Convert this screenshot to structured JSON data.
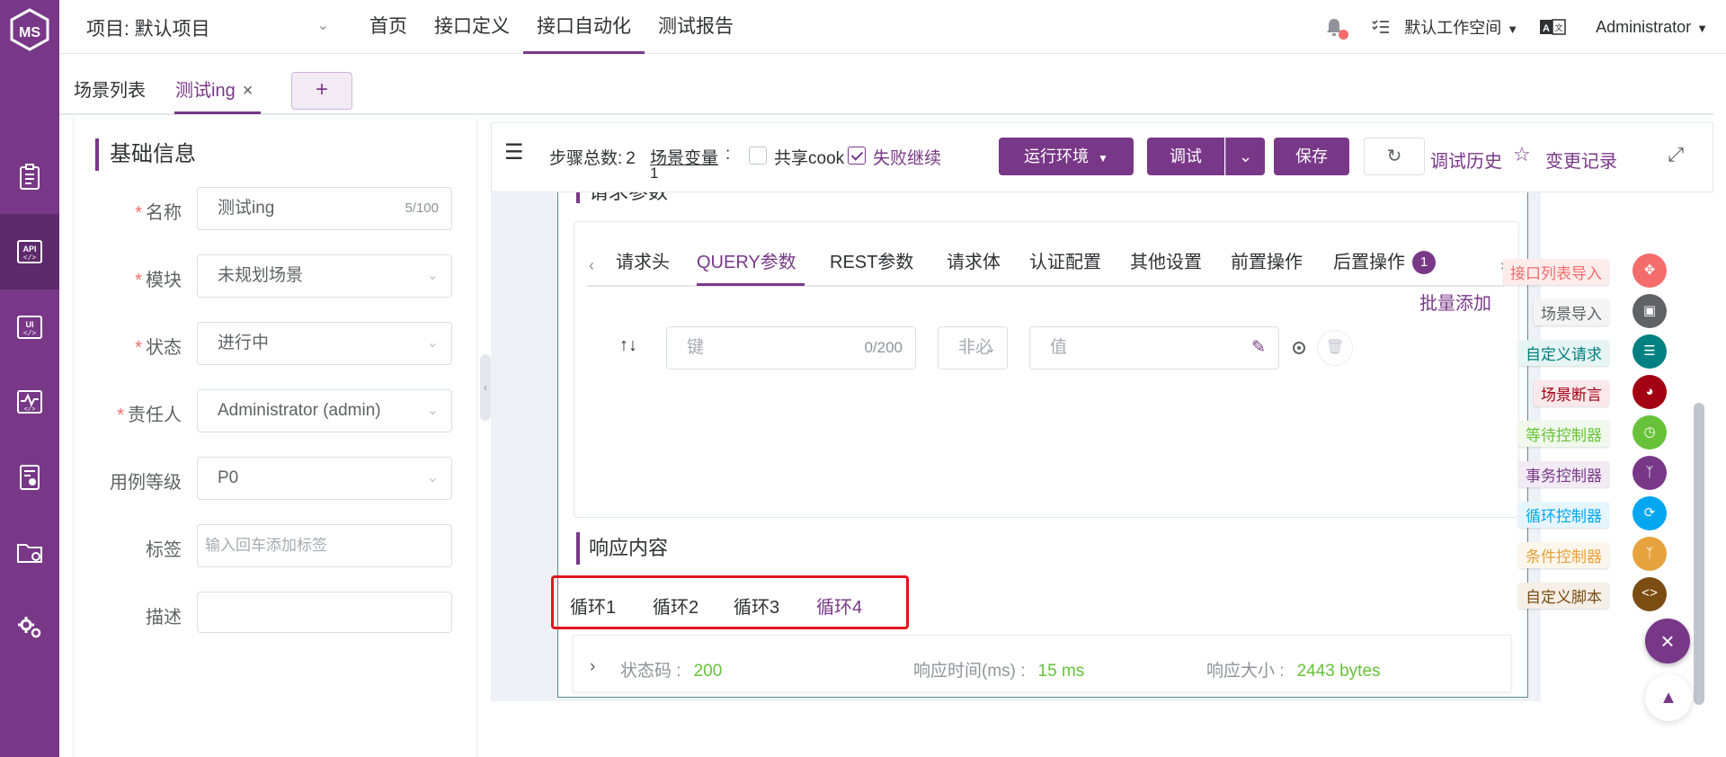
{
  "sidebar": {
    "logo_text": "MS",
    "items": [
      "clipboard-icon",
      "api-icon",
      "ui-icon",
      "performance-icon",
      "report-icon",
      "folder-settings-icon",
      "settings-icon"
    ]
  },
  "header": {
    "project": "项目: 默认项目",
    "nav": [
      "首页",
      "接口定义",
      "接口自动化",
      "测试报告"
    ],
    "workspace": "默认工作空间",
    "user": "Administrator"
  },
  "tabs": {
    "list": "场景列表",
    "active": "测试ing",
    "add": "+"
  },
  "form": {
    "title": "基础信息",
    "fields": [
      {
        "label": "名称",
        "value": "测试ing",
        "count": "5/100"
      },
      {
        "label": "模块",
        "value": "未规划场景"
      },
      {
        "label": "状态",
        "value": "进行中"
      },
      {
        "label": "责任人",
        "value": "Administrator (admin)"
      },
      {
        "label": "用例等级",
        "value": "P0"
      },
      {
        "label": "标签",
        "placeholder": "输入回车添加标签"
      },
      {
        "label": "描述",
        "value": ""
      }
    ]
  },
  "toolbar": {
    "step_total_label": "步骤总数:",
    "step_total": "2",
    "scenario_var": "场景变量",
    "scenario_var_colon": ":",
    "scenario_var_count": "1",
    "share_cookie": "共享cook",
    "fail_continue": "失败继续",
    "env": "运行环境",
    "debug": "调试",
    "save": "保存",
    "debug_history": "调试历史",
    "change_record": "变更记录"
  },
  "request": {
    "tabs": [
      "请求头",
      "QUERY参数",
      "REST参数",
      "请求体",
      "认证配置",
      "其他设置",
      "前置操作",
      "后置操作"
    ],
    "post_badge": "1",
    "batch_add": "批量添加",
    "key_placeholder": "键",
    "key_count": "0/200",
    "required": "非必",
    "value_placeholder": "值"
  },
  "response": {
    "title": "响应内容",
    "loops": [
      "循环1",
      "循环2",
      "循环3",
      "循环4"
    ],
    "status_label": "状态码 :",
    "status": "200",
    "time_label": "响应时间(ms) :",
    "time": "15 ms",
    "size_label": "响应大小 :",
    "size": "2443 bytes"
  },
  "steps": [
    {
      "label": "接口列表导入",
      "color": "#f56c6c",
      "text": "#f56c6c",
      "bg": "#fdecec"
    },
    {
      "label": "场景导入",
      "color": "#606266",
      "text": "#606266",
      "bg": "#f4f4f5"
    },
    {
      "label": "自定义请求",
      "color": "#008080",
      "text": "#008080",
      "bg": "#e6f4f4"
    },
    {
      "label": "场景断言",
      "color": "#a30014",
      "text": "#a30014",
      "bg": "#fbe8ea"
    },
    {
      "label": "等待控制器",
      "color": "#67c23a",
      "text": "#67c23a",
      "bg": "#f0f9eb"
    },
    {
      "label": "事务控制器",
      "color": "#783887",
      "text": "#783887",
      "bg": "#f2ebf4"
    },
    {
      "label": "循环控制器",
      "color": "#02a7f0",
      "text": "#02a7f0",
      "bg": "#e6f6fe"
    },
    {
      "label": "条件控制器",
      "color": "#e6a23c",
      "text": "#e6a23c",
      "bg": "#fdf6ec"
    },
    {
      "label": "自定义脚本",
      "color": "#7b4d12",
      "text": "#7b4d12",
      "bg": "#f5efe7"
    }
  ]
}
